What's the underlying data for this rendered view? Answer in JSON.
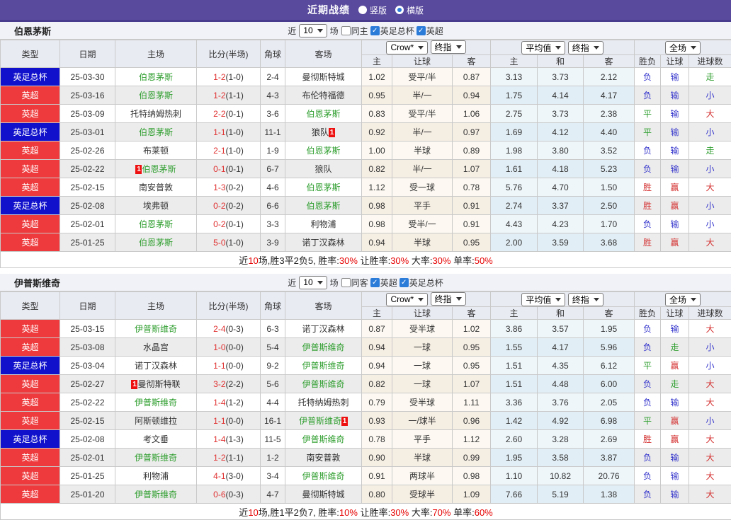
{
  "topbar": {
    "title": "近期战绩",
    "radios": [
      {
        "label": "竖版",
        "selected": false
      },
      {
        "label": "横版",
        "selected": true
      }
    ]
  },
  "columns": {
    "left": [
      "类型",
      "日期",
      "主场",
      "比分(半场)",
      "角球",
      "客场"
    ],
    "odds_sub": [
      "主",
      "让球",
      "客"
    ],
    "avg_sub": [
      "主",
      "和",
      "客"
    ],
    "result_sub": [
      "胜负",
      "让球",
      "进球数"
    ]
  },
  "dropdowns": {
    "odds_company": "Crow*",
    "odds_ref": "终指",
    "avg": "平均值",
    "avg_ref": "终指",
    "full": "全场"
  },
  "colors": {
    "accent_purple": "#5a4a9e",
    "league_cup_blue": "#1111cc",
    "league_epl_red": "#ee3a3c",
    "highlight_team_green": "#2f9e2f",
    "score_red": "#e03030",
    "win_red": "#d43030",
    "draw_green": "#2f9e2f",
    "lose_blue": "#3333cc",
    "summary_red": "#e60000"
  },
  "tables": [
    {
      "team": "伯恩茅斯",
      "filter": {
        "near": "近",
        "games": "10",
        "unit": "场",
        "checkboxes": [
          {
            "label": "同主",
            "checked": false
          },
          {
            "label": "英足总杯",
            "checked": true
          },
          {
            "label": "英超",
            "checked": true
          }
        ]
      },
      "rows": [
        {
          "league": "英足总杯",
          "league_type": "cup",
          "date": "25-03-30",
          "home": "伯恩茅斯",
          "home_hl": true,
          "home_card": "",
          "home_card_pos": "",
          "away": "曼彻斯特城",
          "away_hl": false,
          "away_card": "",
          "away_card_pos": "",
          "score": "1-2",
          "half": "(1-0)",
          "corners": "2-4",
          "odds": [
            "1.02",
            "受平/半",
            "0.87"
          ],
          "avg": [
            "3.13",
            "3.73",
            "2.12"
          ],
          "result": [
            "负",
            "输",
            "走"
          ]
        },
        {
          "league": "英超",
          "league_type": "epl",
          "date": "25-03-16",
          "home": "伯恩茅斯",
          "home_hl": true,
          "home_card": "",
          "home_card_pos": "",
          "away": "布伦特福德",
          "away_hl": false,
          "away_card": "",
          "away_card_pos": "",
          "score": "1-2",
          "half": "(1-1)",
          "corners": "4-3",
          "odds": [
            "0.95",
            "半/一",
            "0.94"
          ],
          "avg": [
            "1.75",
            "4.14",
            "4.17"
          ],
          "result": [
            "负",
            "输",
            "小"
          ]
        },
        {
          "league": "英超",
          "league_type": "epl",
          "date": "25-03-09",
          "home": "托特纳姆热刺",
          "home_hl": false,
          "home_card": "",
          "home_card_pos": "",
          "away": "伯恩茅斯",
          "away_hl": true,
          "away_card": "",
          "away_card_pos": "",
          "score": "2-2",
          "half": "(0-1)",
          "corners": "3-6",
          "odds": [
            "0.83",
            "受平/半",
            "1.06"
          ],
          "avg": [
            "2.75",
            "3.73",
            "2.38"
          ],
          "result": [
            "平",
            "输",
            "大"
          ]
        },
        {
          "league": "英足总杯",
          "league_type": "cup",
          "date": "25-03-01",
          "home": "伯恩茅斯",
          "home_hl": true,
          "home_card": "",
          "home_card_pos": "",
          "away": "狼队",
          "away_hl": false,
          "away_card": "1",
          "away_card_pos": "after",
          "score": "1-1",
          "half": "(1-0)",
          "corners": "11-1",
          "odds": [
            "0.92",
            "半/一",
            "0.97"
          ],
          "avg": [
            "1.69",
            "4.12",
            "4.40"
          ],
          "result": [
            "平",
            "输",
            "小"
          ]
        },
        {
          "league": "英超",
          "league_type": "epl",
          "date": "25-02-26",
          "home": "布莱顿",
          "home_hl": false,
          "home_card": "",
          "home_card_pos": "",
          "away": "伯恩茅斯",
          "away_hl": true,
          "away_card": "",
          "away_card_pos": "",
          "score": "2-1",
          "half": "(1-0)",
          "corners": "1-9",
          "odds": [
            "1.00",
            "半球",
            "0.89"
          ],
          "avg": [
            "1.98",
            "3.80",
            "3.52"
          ],
          "result": [
            "负",
            "输",
            "走"
          ]
        },
        {
          "league": "英超",
          "league_type": "epl",
          "date": "25-02-22",
          "home": "伯恩茅斯",
          "home_hl": true,
          "home_card": "1",
          "home_card_pos": "before",
          "away": "狼队",
          "away_hl": false,
          "away_card": "",
          "away_card_pos": "",
          "score": "0-1",
          "half": "(0-1)",
          "corners": "6-7",
          "odds": [
            "0.82",
            "半/一",
            "1.07"
          ],
          "avg": [
            "1.61",
            "4.18",
            "5.23"
          ],
          "result": [
            "负",
            "输",
            "小"
          ]
        },
        {
          "league": "英超",
          "league_type": "epl",
          "date": "25-02-15",
          "home": "南安普敦",
          "home_hl": false,
          "home_card": "",
          "home_card_pos": "",
          "away": "伯恩茅斯",
          "away_hl": true,
          "away_card": "",
          "away_card_pos": "",
          "score": "1-3",
          "half": "(0-2)",
          "corners": "4-6",
          "odds": [
            "1.12",
            "受一球",
            "0.78"
          ],
          "avg": [
            "5.76",
            "4.70",
            "1.50"
          ],
          "result": [
            "胜",
            "赢",
            "大"
          ]
        },
        {
          "league": "英足总杯",
          "league_type": "cup",
          "date": "25-02-08",
          "home": "埃弗顿",
          "home_hl": false,
          "home_card": "",
          "home_card_pos": "",
          "away": "伯恩茅斯",
          "away_hl": true,
          "away_card": "",
          "away_card_pos": "",
          "score": "0-2",
          "half": "(0-2)",
          "corners": "6-6",
          "odds": [
            "0.98",
            "平手",
            "0.91"
          ],
          "avg": [
            "2.74",
            "3.37",
            "2.50"
          ],
          "result": [
            "胜",
            "赢",
            "小"
          ]
        },
        {
          "league": "英超",
          "league_type": "epl",
          "date": "25-02-01",
          "home": "伯恩茅斯",
          "home_hl": true,
          "home_card": "",
          "home_card_pos": "",
          "away": "利物浦",
          "away_hl": false,
          "away_card": "",
          "away_card_pos": "",
          "score": "0-2",
          "half": "(0-1)",
          "corners": "3-3",
          "odds": [
            "0.98",
            "受半/一",
            "0.91"
          ],
          "avg": [
            "4.43",
            "4.23",
            "1.70"
          ],
          "result": [
            "负",
            "输",
            "小"
          ]
        },
        {
          "league": "英超",
          "league_type": "epl",
          "date": "25-01-25",
          "home": "伯恩茅斯",
          "home_hl": true,
          "home_card": "",
          "home_card_pos": "",
          "away": "诺丁汉森林",
          "away_hl": false,
          "away_card": "",
          "away_card_pos": "",
          "score": "5-0",
          "half": "(1-0)",
          "corners": "3-9",
          "odds": [
            "0.94",
            "半球",
            "0.95"
          ],
          "avg": [
            "2.00",
            "3.59",
            "3.68"
          ],
          "result": [
            "胜",
            "赢",
            "大"
          ]
        }
      ],
      "footer": [
        {
          "t": "近"
        },
        {
          "t": "10",
          "red": true
        },
        {
          "t": "场,胜3平2负5, 胜率:"
        },
        {
          "t": "30%",
          "red": true
        },
        {
          "t": " 让胜率:"
        },
        {
          "t": "30%",
          "red": true
        },
        {
          "t": " 大率:"
        },
        {
          "t": "30%",
          "red": true
        },
        {
          "t": " 单率:"
        },
        {
          "t": "50%",
          "red": true
        }
      ]
    },
    {
      "team": "伊普斯维奇",
      "filter": {
        "near": "近",
        "games": "10",
        "unit": "场",
        "checkboxes": [
          {
            "label": "同客",
            "checked": false
          },
          {
            "label": "英超",
            "checked": true
          },
          {
            "label": "英足总杯",
            "checked": true
          }
        ]
      },
      "rows": [
        {
          "league": "英超",
          "league_type": "epl",
          "date": "25-03-15",
          "home": "伊普斯维奇",
          "home_hl": true,
          "home_card": "",
          "home_card_pos": "",
          "away": "诺丁汉森林",
          "away_hl": false,
          "away_card": "",
          "away_card_pos": "",
          "score": "2-4",
          "half": "(0-3)",
          "corners": "6-3",
          "odds": [
            "0.87",
            "受半球",
            "1.02"
          ],
          "avg": [
            "3.86",
            "3.57",
            "1.95"
          ],
          "result": [
            "负",
            "输",
            "大"
          ]
        },
        {
          "league": "英超",
          "league_type": "epl",
          "date": "25-03-08",
          "home": "水晶宫",
          "home_hl": false,
          "home_card": "",
          "home_card_pos": "",
          "away": "伊普斯维奇",
          "away_hl": true,
          "away_card": "",
          "away_card_pos": "",
          "score": "1-0",
          "half": "(0-0)",
          "corners": "5-4",
          "odds": [
            "0.94",
            "一球",
            "0.95"
          ],
          "avg": [
            "1.55",
            "4.17",
            "5.96"
          ],
          "result": [
            "负",
            "走",
            "小"
          ]
        },
        {
          "league": "英足总杯",
          "league_type": "cup",
          "date": "25-03-04",
          "home": "诺丁汉森林",
          "home_hl": false,
          "home_card": "",
          "home_card_pos": "",
          "away": "伊普斯维奇",
          "away_hl": true,
          "away_card": "",
          "away_card_pos": "",
          "score": "1-1",
          "half": "(0-0)",
          "corners": "9-2",
          "odds": [
            "0.94",
            "一球",
            "0.95"
          ],
          "avg": [
            "1.51",
            "4.35",
            "6.12"
          ],
          "result": [
            "平",
            "赢",
            "小"
          ]
        },
        {
          "league": "英超",
          "league_type": "epl",
          "date": "25-02-27",
          "home": "曼彻斯特联",
          "home_hl": false,
          "home_card": "1",
          "home_card_pos": "before",
          "away": "伊普斯维奇",
          "away_hl": true,
          "away_card": "",
          "away_card_pos": "",
          "score": "3-2",
          "half": "(2-2)",
          "corners": "5-6",
          "odds": [
            "0.82",
            "一球",
            "1.07"
          ],
          "avg": [
            "1.51",
            "4.48",
            "6.00"
          ],
          "result": [
            "负",
            "走",
            "大"
          ]
        },
        {
          "league": "英超",
          "league_type": "epl",
          "date": "25-02-22",
          "home": "伊普斯维奇",
          "home_hl": true,
          "home_card": "",
          "home_card_pos": "",
          "away": "托特纳姆热刺",
          "away_hl": false,
          "away_card": "",
          "away_card_pos": "",
          "score": "1-4",
          "half": "(1-2)",
          "corners": "4-4",
          "odds": [
            "0.79",
            "受半球",
            "1.11"
          ],
          "avg": [
            "3.36",
            "3.76",
            "2.05"
          ],
          "result": [
            "负",
            "输",
            "大"
          ]
        },
        {
          "league": "英超",
          "league_type": "epl",
          "date": "25-02-15",
          "home": "阿斯顿维拉",
          "home_hl": false,
          "home_card": "",
          "home_card_pos": "",
          "away": "伊普斯维奇",
          "away_hl": true,
          "away_card": "1",
          "away_card_pos": "after",
          "score": "1-1",
          "half": "(0-0)",
          "corners": "16-1",
          "odds": [
            "0.93",
            "一/球半",
            "0.96"
          ],
          "avg": [
            "1.42",
            "4.92",
            "6.98"
          ],
          "result": [
            "平",
            "赢",
            "小"
          ]
        },
        {
          "league": "英足总杯",
          "league_type": "cup",
          "date": "25-02-08",
          "home": "考文垂",
          "home_hl": false,
          "home_card": "",
          "home_card_pos": "",
          "away": "伊普斯维奇",
          "away_hl": true,
          "away_card": "",
          "away_card_pos": "",
          "score": "1-4",
          "half": "(1-3)",
          "corners": "11-5",
          "odds": [
            "0.78",
            "平手",
            "1.12"
          ],
          "avg": [
            "2.60",
            "3.28",
            "2.69"
          ],
          "result": [
            "胜",
            "赢",
            "大"
          ]
        },
        {
          "league": "英超",
          "league_type": "epl",
          "date": "25-02-01",
          "home": "伊普斯维奇",
          "home_hl": true,
          "home_card": "",
          "home_card_pos": "",
          "away": "南安普敦",
          "away_hl": false,
          "away_card": "",
          "away_card_pos": "",
          "score": "1-2",
          "half": "(1-1)",
          "corners": "1-2",
          "odds": [
            "0.90",
            "半球",
            "0.99"
          ],
          "avg": [
            "1.95",
            "3.58",
            "3.87"
          ],
          "result": [
            "负",
            "输",
            "大"
          ]
        },
        {
          "league": "英超",
          "league_type": "epl",
          "date": "25-01-25",
          "home": "利物浦",
          "home_hl": false,
          "home_card": "",
          "home_card_pos": "",
          "away": "伊普斯维奇",
          "away_hl": true,
          "away_card": "",
          "away_card_pos": "",
          "score": "4-1",
          "half": "(3-0)",
          "corners": "3-4",
          "odds": [
            "0.91",
            "两球半",
            "0.98"
          ],
          "avg": [
            "1.10",
            "10.82",
            "20.76"
          ],
          "result": [
            "负",
            "输",
            "大"
          ]
        },
        {
          "league": "英超",
          "league_type": "epl",
          "date": "25-01-20",
          "home": "伊普斯维奇",
          "home_hl": true,
          "home_card": "",
          "home_card_pos": "",
          "away": "曼彻斯特城",
          "away_hl": false,
          "away_card": "",
          "away_card_pos": "",
          "score": "0-6",
          "half": "(0-3)",
          "corners": "4-7",
          "odds": [
            "0.80",
            "受球半",
            "1.09"
          ],
          "avg": [
            "7.66",
            "5.19",
            "1.38"
          ],
          "result": [
            "负",
            "输",
            "大"
          ]
        }
      ],
      "footer": [
        {
          "t": "近"
        },
        {
          "t": "10",
          "red": true
        },
        {
          "t": "场,胜1平2负7, 胜率:"
        },
        {
          "t": "10%",
          "red": true
        },
        {
          "t": " 让胜率:"
        },
        {
          "t": "30%",
          "red": true
        },
        {
          "t": " 大率:"
        },
        {
          "t": "70%",
          "red": true
        },
        {
          "t": " 单率:"
        },
        {
          "t": "60%",
          "red": true
        }
      ]
    }
  ]
}
